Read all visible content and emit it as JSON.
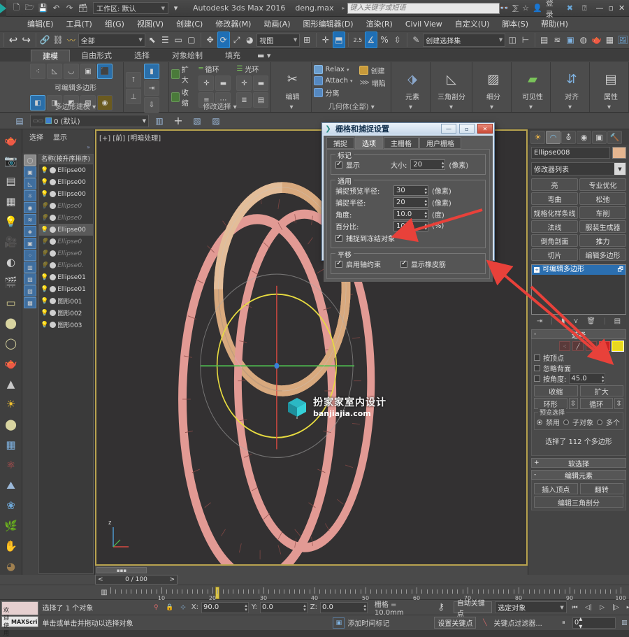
{
  "titlebar": {
    "workspace_label": "工作区: 默认",
    "app_title": "Autodesk 3ds Max 2016",
    "file_name": "deng.max",
    "search_placeholder": "键入关键字或短语",
    "login_label": "登录",
    "qat_icons": [
      "new-icon",
      "open-icon",
      "save-icon",
      "undo-icon",
      "redo-icon",
      "project-icon"
    ],
    "right_icons": [
      "binoculars-icon",
      "signin-icon",
      "star-icon",
      "user-icon",
      "exchange-icon",
      "help-icon"
    ],
    "window_buttons": [
      "minimize",
      "maximize",
      "close"
    ]
  },
  "menubar": {
    "items": [
      "编辑(E)",
      "工具(T)",
      "组(G)",
      "视图(V)",
      "创建(C)",
      "修改器(M)",
      "动画(A)",
      "图形编辑器(D)",
      "渲染(R)",
      "Civil View",
      "自定义(U)",
      "脚本(S)",
      "帮助(H)"
    ]
  },
  "maintoolbar": {
    "selection_filter": "全部",
    "ref_coord": "视图",
    "named_selection_set": "创建选择集",
    "snap_angle_label": "2.5",
    "snap_percent_label": "%",
    "icons": [
      "undo-icon",
      "redo-icon",
      "select-link-icon",
      "unlink-icon",
      "bind-space-warp-icon",
      "select-object-icon",
      "select-by-name-icon",
      "rect-select-icon",
      "window-crossing-icon",
      "select-move-icon",
      "select-rotate-icon",
      "select-scale-icon",
      "placement-icon",
      "mirror-icon",
      "align-icon",
      "layer-manager-icon",
      "curve-editor-icon",
      "schematic-view-icon",
      "material-editor-icon",
      "render-setup-icon",
      "render-frame-icon",
      "render-production-icon"
    ]
  },
  "ribbon": {
    "tabs": [
      "建模",
      "自由形式",
      "选择",
      "对象绘制",
      "填充"
    ],
    "active_tab": "建模",
    "groups": [
      {
        "title": "多边形建模",
        "sub_label": "可编辑多边形",
        "top_icons": [
          "vertex-icon",
          "edge-icon",
          "border-icon",
          "polygon-icon",
          "element-icon"
        ],
        "bottom_icons": [
          "generate-topology-icon",
          "symmetry-icon",
          "paint-deform-icon",
          "swift-loop-icon",
          "pivot-icon"
        ]
      },
      {
        "title": "修改选择",
        "buttons": [
          "扩大",
          "收缩",
          "循环",
          "光环"
        ]
      },
      {
        "title": "",
        "big_label": "编辑"
      },
      {
        "title": "几何体(全部)",
        "items": [
          "Relax",
          "Attach",
          "分离",
          "创建",
          "塌陷"
        ]
      }
    ],
    "big_buttons": [
      {
        "label": "元素",
        "icon": "element-big-icon"
      },
      {
        "label": "三角剖分",
        "icon": "triangulate-icon"
      },
      {
        "label": "细分",
        "icon": "subdivide-icon"
      },
      {
        "label": "可见性",
        "icon": "visibility-icon"
      },
      {
        "label": "对齐",
        "icon": "align-big-icon"
      },
      {
        "label": "属性",
        "icon": "properties-icon"
      }
    ]
  },
  "layertoolbar": {
    "current_layer": "0 (默认)",
    "icons": [
      "layer-manager-icon",
      "layer-create-icon",
      "add-to-layer-icon",
      "select-layer-icon",
      "set-layer-icon"
    ]
  },
  "scene_explorer": {
    "tabs": [
      "选择",
      "显示"
    ],
    "column_header": "名称(按升序排序)",
    "items": [
      {
        "name": "Ellipse00",
        "hidden": false,
        "selected": false
      },
      {
        "name": "Ellipse00",
        "hidden": false,
        "selected": false
      },
      {
        "name": "Ellipse00",
        "hidden": false,
        "selected": false
      },
      {
        "name": "Ellipse0",
        "hidden": true,
        "selected": false
      },
      {
        "name": "Ellipse0",
        "hidden": true,
        "selected": false
      },
      {
        "name": "Ellipse00",
        "hidden": false,
        "selected": true
      },
      {
        "name": "Ellipse0",
        "hidden": true,
        "selected": false
      },
      {
        "name": "Ellipse0",
        "hidden": true,
        "selected": false
      },
      {
        "name": "Ellipse0.",
        "hidden": true,
        "selected": false
      },
      {
        "name": "Ellipse01",
        "hidden": false,
        "selected": false
      },
      {
        "name": "Ellipse01",
        "hidden": false,
        "selected": false
      },
      {
        "name": "图形001",
        "hidden": false,
        "selected": false
      },
      {
        "name": "图形002",
        "hidden": false,
        "selected": false
      },
      {
        "name": "图形003",
        "hidden": false,
        "selected": false
      }
    ]
  },
  "left_rail": {
    "icons": [
      "teapot-icon",
      "camera-icon",
      "list-icon",
      "grid-icon",
      "light-icon",
      "camera2-icon",
      "shade-icon",
      "render-icon",
      "box-icon",
      "sphere-icon",
      "cone-icon",
      "sun-icon",
      "sphere2-icon",
      "grid2-icon",
      "atom-icon",
      "pyramid-icon",
      "flower-icon",
      "grass-icon",
      "hand-icon",
      "ball-icon"
    ]
  },
  "viewport": {
    "label": "[+] [前] [明暗处理]",
    "watermark_title": "扮家家室内设计",
    "watermark_site": "banjiajia.com",
    "axis_label": "z"
  },
  "command_panel": {
    "tabs": [
      "create-tab",
      "modify-tab",
      "hierarchy-tab",
      "motion-tab",
      "display-tab",
      "utilities-tab"
    ],
    "active_tab_index": 1,
    "object_name": "Ellipse008",
    "object_color": "#e5b690",
    "modifier_list_label": "修改器列表",
    "modifier_buttons": [
      "亮",
      "专业优化",
      "弯曲",
      "松弛",
      "规格化样条线",
      "车削",
      "法线",
      "服装生成器",
      "倒角剖面",
      "推力",
      "切片",
      "编辑多边形"
    ],
    "stack_item": "可编辑多边形",
    "selection_rollout": {
      "title": "选择",
      "sub_levels": [
        "vertex-level",
        "edge-level",
        "border-level",
        "polygon-level",
        "element-level"
      ],
      "active_sub_level": 4,
      "checkboxes": [
        "按顶点",
        "忽略背面",
        "按角度:"
      ],
      "angle_value": "45.0",
      "buttons": [
        "收缩",
        "扩大",
        "环形",
        "循环"
      ],
      "preview_title": "预览选择",
      "preview_options": [
        "禁用",
        "子对象",
        "多个"
      ],
      "preview_selected": "禁用",
      "status": "选择了 112 个多边形"
    },
    "soft_selection_title": "软选择",
    "edit_elements_title": "编辑元素",
    "edit_buttons": [
      "插入顶点",
      "翻转",
      "编辑三角剖分"
    ]
  },
  "dialog": {
    "title": "栅格和捕捉设置",
    "icon": "grid-snap-icon",
    "window_buttons": [
      "minimize",
      "maximize",
      "close"
    ],
    "tabs": [
      "捕捉",
      "选项",
      "主栅格",
      "用户栅格"
    ],
    "active_tab": "选项",
    "marker_group": {
      "legend": "标记",
      "display_label": "显示",
      "display_checked": true,
      "size_label": "大小:",
      "size_value": "20",
      "size_unit": "(像素)"
    },
    "general_group": {
      "legend": "通用",
      "rows": [
        {
          "label": "捕捉预览半径:",
          "value": "30",
          "unit": "(像素)"
        },
        {
          "label": "捕捉半径:",
          "value": "20",
          "unit": "(像素)"
        },
        {
          "label": "角度:",
          "value": "10.0",
          "unit": "(度)"
        },
        {
          "label": "百分比:",
          "value": "10.0",
          "unit": "(%)"
        }
      ],
      "checkbox_label": "捕捉到冻结对象",
      "checkbox_checked": true
    },
    "translation_group": {
      "legend": "平移",
      "check1": "启用轴约束",
      "check1_checked": true,
      "check2": "显示橡皮筋",
      "check2_checked": true
    }
  },
  "timeline": {
    "frame_display": "0 / 100",
    "prev_arrow": "<",
    "next_arrow": ">",
    "ruler_labels": [
      "10",
      "20",
      "30",
      "40",
      "50",
      "60",
      "70",
      "80",
      "90",
      "100"
    ],
    "ruler_max": 100
  },
  "statusbar": {
    "welcome_label": "欢迎使用",
    "welcome_brand": "MAXScri",
    "selection_status": "选择了 1 个对象",
    "prompt": "单击或单击并拖动以选择对象",
    "coords": [
      {
        "label": "X:",
        "value": "90.0"
      },
      {
        "label": "Y:",
        "value": "0.0"
      },
      {
        "label": "Z:",
        "value": "0.0"
      }
    ],
    "grid_info": "栅格 = 10.0mm",
    "add_time_tag": "添加时间标记",
    "auto_key": "自动关键点",
    "set_key": "设置关键点",
    "key_filters": "关键点过滤器...",
    "selection_mode": "选定对象",
    "frame_value": "0",
    "nav_icons": [
      "goto-start-icon",
      "prev-frame-icon",
      "play-icon",
      "next-frame-icon",
      "goto-end-icon",
      "key-mode-icon"
    ],
    "view_icons": [
      "zoom-icon",
      "zoom-all-icon",
      "zoom-extents-icon",
      "zoom-region-icon",
      "pan-icon",
      "orbit-icon",
      "maximize-viewport-icon"
    ]
  },
  "colors": {
    "accent_blue": "#2b6fb0",
    "viewport_bg": "#333132",
    "panel_bg": "#474747",
    "arrow_red": "#e8413a",
    "highlight_yellow": "#e8d820"
  }
}
